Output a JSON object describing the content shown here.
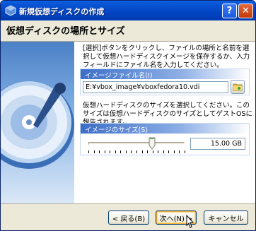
{
  "window": {
    "title": "新規仮想ディスクの作成",
    "help_label": "?",
    "close_label": "✕"
  },
  "page": {
    "title": "仮想ディスクの場所とサイズ"
  },
  "description_file": "[選択]ボタンをクリックし、ファイルの場所と名前を選択して仮想ハードディスクイメージを保存するか、入力フィールドにファイル名を入力してください。",
  "file_group": {
    "label": "イメージファイル名(I)",
    "value": "E:¥vbox_image¥vboxfedora10.vdi"
  },
  "description_size": "仮想ハードディスクのサイズを選択してください。このサイズは仮想ハードディスクのサイズとしてゲストOSに報告されます。",
  "size_group": {
    "label": "イメージのサイズ(S)",
    "value": "15.00 GB",
    "slider_fraction": 0.66
  },
  "buttons": {
    "back": "< 戻る(B)",
    "next": "次へ(N) >",
    "cancel": "キャンセル"
  }
}
